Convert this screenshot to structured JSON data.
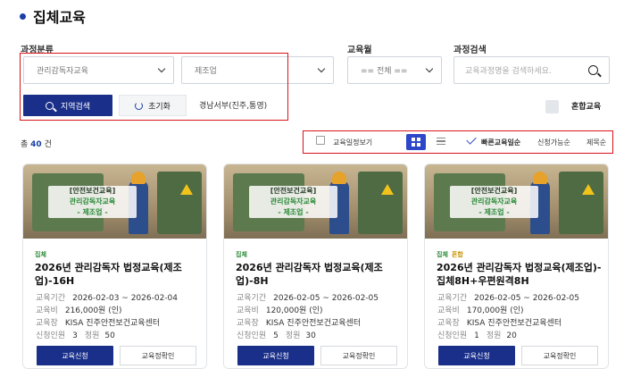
{
  "page": {
    "title": "집체교육"
  },
  "filters": {
    "category_label": "과정분류",
    "category_value": "관리감독자교육",
    "subcategory_value": "제조업",
    "month_label": "교육월",
    "month_value": "== 전체 ==",
    "search_label": "과정검색",
    "search_placeholder": "교육과정명을 검색하세요.",
    "region_search_button": "지역검색",
    "reset_button": "초기화",
    "region_text": "경남서부(진주,통영)",
    "mixed_label": "혼합교육"
  },
  "toolbar": {
    "total_prefix": "총",
    "total_count": "40",
    "total_suffix": "건",
    "calendar_view": "교육일정보기",
    "sort_fast": "빠른교육일순",
    "sort_available": "신청가능순",
    "sort_title": "제목순"
  },
  "colors": {
    "primary": "#1a2f8a",
    "accent": "#2c47c8",
    "highlight": "#d9141b",
    "tag_green": "#2e8b3a"
  },
  "cards": [
    {
      "badge_1": "[안전보건교육]",
      "badge_2": "관리감독자교육",
      "badge_3": "- 제조업 -",
      "tag": "집체",
      "tag_2": "",
      "title": "2026년 관리감독자 법정교육(제조업)-16H",
      "period_label": "교육기간",
      "period": "2026-02-03 ~ 2026-02-04",
      "fee_label": "교육비",
      "fee": "216,000원 (인)",
      "place_label": "교육장",
      "place": "KISA 진주안전보건교육센터",
      "applied_label": "신청인원",
      "applied": "3",
      "capacity_label": "정원",
      "capacity": "50",
      "apply_button": "교육신청",
      "detail_button": "교육정확인"
    },
    {
      "badge_1": "[안전보건교육]",
      "badge_2": "관리감독자교육",
      "badge_3": "- 제조업 -",
      "tag": "집체",
      "tag_2": "",
      "title": "2026년 관리감독자 법정교육(제조업)-8H",
      "period_label": "교육기간",
      "period": "2026-02-05 ~ 2026-02-05",
      "fee_label": "교육비",
      "fee": "120,000원 (인)",
      "place_label": "교육장",
      "place": "KISA 진주안전보건교육센터",
      "applied_label": "신청인원",
      "applied": "5",
      "capacity_label": "정원",
      "capacity": "30",
      "apply_button": "교육신청",
      "detail_button": "교육정확인"
    },
    {
      "badge_1": "[안전보건교육]",
      "badge_2": "관리감독자교육",
      "badge_3": "- 제조업 -",
      "tag": "집체",
      "tag_2": "혼합",
      "title": "2026년 관리감독자 법정교육(제조업)-집체8H+우편원격8H",
      "period_label": "교육기간",
      "period": "2026-02-05 ~ 2026-02-05",
      "fee_label": "교육비",
      "fee": "170,000원 (인)",
      "place_label": "교육장",
      "place": "KISA 진주안전보건교육센터",
      "applied_label": "신청인원",
      "applied": "1",
      "capacity_label": "정원",
      "capacity": "20",
      "apply_button": "교육신청",
      "detail_button": "교육정확인"
    }
  ]
}
